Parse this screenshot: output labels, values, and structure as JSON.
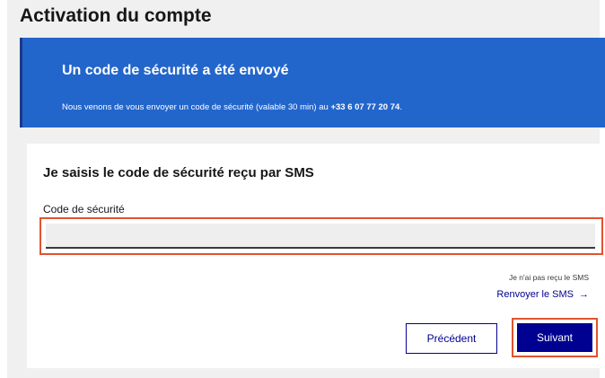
{
  "page": {
    "title": "Activation du compte"
  },
  "banner": {
    "title": "Un code de sécurité a été envoyé",
    "text_before": "Nous venons de vous envoyer un code de sécurité (valable 30 min) au ",
    "phone": "+33 6 07 77 20 74",
    "text_after": "."
  },
  "form": {
    "title": "Je saisis le code de sécurité reçu par SMS",
    "code_label": "Code de sécurité",
    "code_value": "",
    "help_text": "Je n'ai pas reçu le SMS",
    "resend_label": "Renvoyer le SMS",
    "resend_icon": "→",
    "prev_label": "Précédent",
    "next_label": "Suivant"
  },
  "colors": {
    "banner": "#2266cc",
    "primary": "#000091",
    "highlight": "#e0542f"
  }
}
